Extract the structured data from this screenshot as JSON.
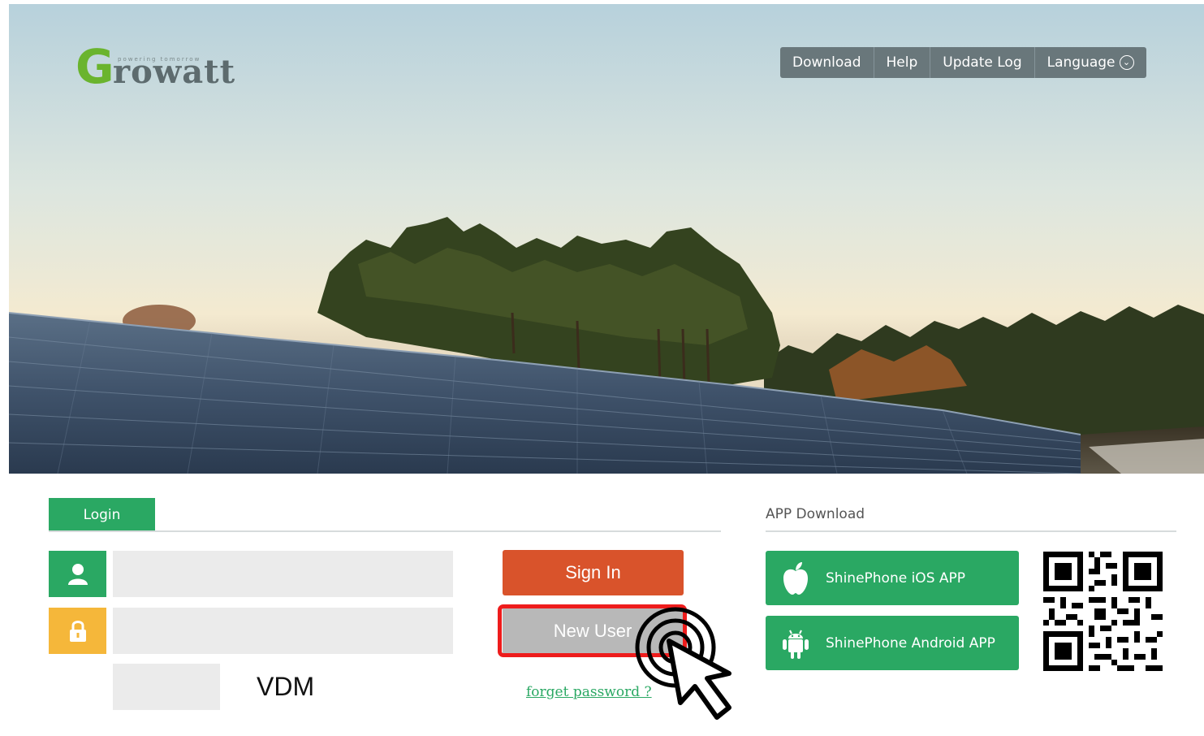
{
  "brand": {
    "logo_letter": "G",
    "logo_rest": "rowatt",
    "tagline": "powering tomorrow",
    "primary_color": "#2aa863",
    "accent_orange": "#d9532b",
    "lock_color": "#f5b73a"
  },
  "topnav": {
    "items": [
      {
        "label": "Download"
      },
      {
        "label": "Help"
      },
      {
        "label": "Update Log"
      },
      {
        "label": "Language"
      }
    ],
    "language_icon": "chevron-down-circle-icon"
  },
  "login": {
    "tab_label": "Login",
    "username_value": "",
    "password_value": "",
    "captcha_value": "",
    "captcha_code": "VDM",
    "sign_in_label": "Sign In",
    "new_user_label": "New User",
    "forget_password_label": "forget password ?"
  },
  "app_download": {
    "title": "APP Download",
    "ios_label": "ShinePhone iOS APP",
    "android_label": "ShinePhone Android APP"
  }
}
